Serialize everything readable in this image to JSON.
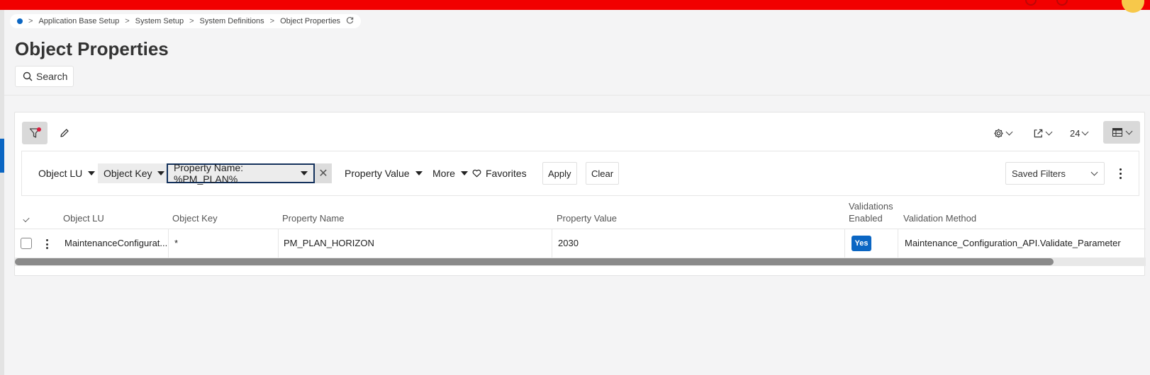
{
  "breadcrumb": {
    "items": [
      "Application Base Setup",
      "System Setup",
      "System Definitions",
      "Object Properties"
    ],
    "separator": ">",
    "refresh_icon": "refresh-icon"
  },
  "page": {
    "title": "Object Properties",
    "search_label": "Search"
  },
  "toolbar": {
    "page_size": "24"
  },
  "filters": {
    "object_lu": "Object LU",
    "object_key": "Object Key",
    "property_name": "Property Name: %PM_PLAN%",
    "property_value": "Property Value",
    "more": "More",
    "favorites": "Favorites",
    "apply": "Apply",
    "clear": "Clear",
    "saved_filters": "Saved Filters"
  },
  "table": {
    "columns": {
      "object_lu": "Object LU",
      "object_key": "Object Key",
      "property_name": "Property Name",
      "property_value": "Property Value",
      "validations_enabled_1": "Validations",
      "validations_enabled_2": "Enabled",
      "validation_method": "Validation Method"
    },
    "rows": [
      {
        "object_lu": "MaintenanceConfigurat...",
        "object_key": "*",
        "property_name": "PM_PLAN_HORIZON",
        "property_value": "2030",
        "validations_enabled": "Yes",
        "validation_method": "Maintenance_Configuration_API.Validate_Parameter"
      }
    ]
  },
  "colors": {
    "topbar": "#f20000",
    "accent": "#0b66c3",
    "active_filter_border": "#13315c"
  }
}
